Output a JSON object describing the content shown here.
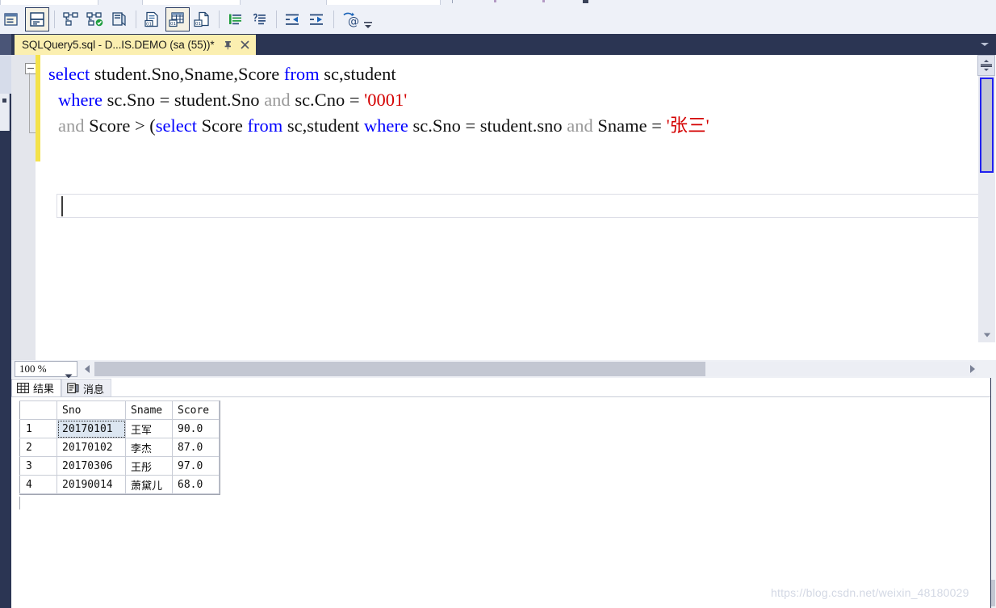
{
  "app": {
    "name": "SQL Server Management Studio",
    "watermark": "https://blog.csdn.net/weixin_48180029"
  },
  "toolbar": {
    "buttons": [
      {
        "name": "object-explorer-details-icon",
        "label": "Object Explorer Details",
        "selected": false
      },
      {
        "name": "split-window-icon",
        "label": "Split Window",
        "selected": true
      },
      {
        "name": "parse-query-icon",
        "label": "Parse",
        "selected": false
      },
      {
        "name": "display-estimated-plan-icon",
        "label": "Display Estimated Execution Plan",
        "selected": false
      },
      {
        "name": "include-actual-plan-icon",
        "label": "Include Actual Execution Plan",
        "selected": false
      },
      {
        "name": "results-to-text-icon",
        "label": "Results to Text",
        "selected": false
      },
      {
        "name": "results-to-grid-icon",
        "label": "Results to Grid",
        "selected": true
      },
      {
        "name": "results-to-file-icon",
        "label": "Results to File",
        "selected": false
      },
      {
        "name": "comment-lines-icon",
        "label": "Comment out the selected lines",
        "selected": false
      },
      {
        "name": "uncomment-lines-icon",
        "label": "Uncomment the selected lines",
        "selected": false
      },
      {
        "name": "decrease-indent-icon",
        "label": "Decrease Indent",
        "selected": false
      },
      {
        "name": "increase-indent-icon",
        "label": "Increase Indent",
        "selected": false
      },
      {
        "name": "specify-values-for-template-parameters-icon",
        "label": "Specify Values for Template Parameters",
        "selected": false
      }
    ],
    "overflow_label": "Toolbar Options"
  },
  "document_tab": {
    "title": "SQLQuery5.sql - D...IS.DEMO (sa (55))*",
    "pin_icon": "pin-icon",
    "close_icon": "close-icon",
    "tab_list_icon": "chevron-down-icon"
  },
  "editor": {
    "lines": [
      {
        "tokens": [
          {
            "t": "select",
            "c": "kw"
          },
          {
            "t": " student.Sno,Sname,Score ",
            "c": "pl"
          },
          {
            "t": "from",
            "c": "kw"
          },
          {
            "t": " sc,student",
            "c": "pl"
          }
        ]
      },
      {
        "tokens": [
          {
            "t": "where",
            "c": "kw"
          },
          {
            "t": " sc.Sno = student.Sno ",
            "c": "pl"
          },
          {
            "t": "and",
            "c": "gy"
          },
          {
            "t": " sc.Cno = ",
            "c": "pl"
          },
          {
            "t": "'0001'",
            "c": "st"
          }
        ]
      },
      {
        "tokens": [
          {
            "t": "and",
            "c": "gy"
          },
          {
            "t": " Score > (",
            "c": "pl"
          },
          {
            "t": "select",
            "c": "kw"
          },
          {
            "t": " Score ",
            "c": "pl"
          },
          {
            "t": "from",
            "c": "kw"
          },
          {
            "t": " sc,student ",
            "c": "pl"
          },
          {
            "t": "where",
            "c": "kw"
          },
          {
            "t": " sc.Sno = student.sno ",
            "c": "pl"
          },
          {
            "t": "and",
            "c": "gy"
          },
          {
            "t": " Sname = ",
            "c": "pl"
          },
          {
            "t": "'张三'",
            "c": "st"
          }
        ]
      },
      {
        "tokens": []
      }
    ],
    "fold_marker": "collapse-minus-icon",
    "split_icon": "split-pane-icon",
    "scroll_up_icon": "scroll-up-arrow-icon",
    "scroll_down_icon": "scroll-down-arrow-icon"
  },
  "zoombar": {
    "zoom_value": "100 %",
    "zoom_chevron": "chevron-down-icon",
    "scroll_left_icon": "scroll-left-arrow-icon",
    "scroll_right_icon": "scroll-right-arrow-icon"
  },
  "results": {
    "tabs": [
      {
        "label": "结果",
        "icon": "grid-icon",
        "active": true
      },
      {
        "label": "消息",
        "icon": "message-icon",
        "active": false
      }
    ],
    "grid": {
      "row_number_header": "",
      "columns": [
        "Sno",
        "Sname",
        "Score"
      ],
      "rows": [
        {
          "n": "1",
          "Sno": "20170101",
          "Sname": "王军",
          "Score": "90.0"
        },
        {
          "n": "2",
          "Sno": "20170102",
          "Sname": "李杰",
          "Score": "87.0"
        },
        {
          "n": "3",
          "Sno": "20170306",
          "Sname": "王彤",
          "Score": "97.0"
        },
        {
          "n": "4",
          "Sno": "20190014",
          "Sname": "萧黛儿",
          "Score": "68.0"
        }
      ],
      "selected_cell": {
        "row": 0,
        "column": "Sno"
      }
    }
  },
  "colors": {
    "keyword": "#0000ff",
    "string": "#d40000",
    "operator_word": "#9a9a9a",
    "tab_active_bg": "#fbefb0",
    "chrome_dark": "#2b3553",
    "toolbar_bg": "#eef1f8"
  }
}
